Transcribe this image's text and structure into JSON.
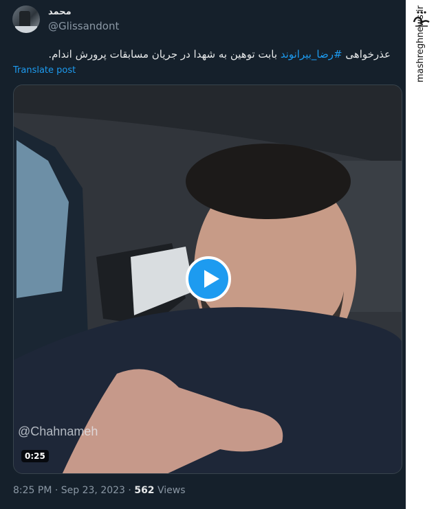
{
  "author": {
    "display_name": "محمد",
    "handle": "@Glissandont"
  },
  "tweet": {
    "text_before": "عذرخواهی ",
    "hashtag": "#رضا_بیرانوند",
    "text_after": " بابت توهین به شهدا در جریان مسابقات پرورش اندام.",
    "translate_label": "Translate post"
  },
  "video": {
    "watermark": "@Chahnameh",
    "duration": "0:25",
    "play_icon": "play-icon"
  },
  "meta": {
    "time": "8:25 PM",
    "separator": "·",
    "date": "Sep 23, 2023",
    "views_count": "562",
    "views_label": "Views"
  },
  "branding": {
    "logo_text": "مشرق",
    "site": "mashreghnews.ir"
  },
  "colors": {
    "background": "#15202b",
    "link": "#1d9bf0",
    "secondary_text": "#8b98a5"
  }
}
